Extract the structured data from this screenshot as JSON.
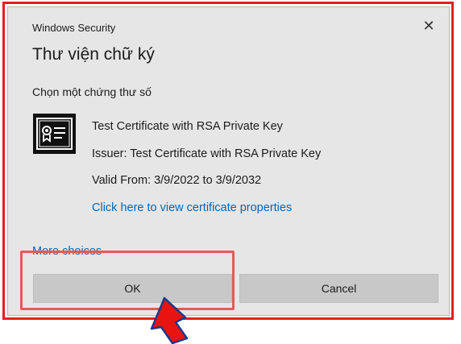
{
  "window": {
    "title": "Windows Security",
    "close_glyph": "✕"
  },
  "dialog": {
    "heading": "Thư viện chữ ký",
    "subheading": "Chọn một chứng thư số"
  },
  "certificate": {
    "icon": "certificate-icon",
    "name": "Test Certificate with RSA Private Key",
    "issuer": "Issuer: Test Certificate with RSA Private Key",
    "valid": "Valid From: 3/9/2022 to 3/9/2032",
    "view_link": "Click here to view certificate properties"
  },
  "more_choices": "More choices",
  "buttons": {
    "ok": "OK",
    "cancel": "Cancel"
  },
  "colors": {
    "outer_border": "#e41e1e",
    "highlight": "#e55a5a",
    "link": "#0067c0",
    "arrow": "#e8140f"
  }
}
